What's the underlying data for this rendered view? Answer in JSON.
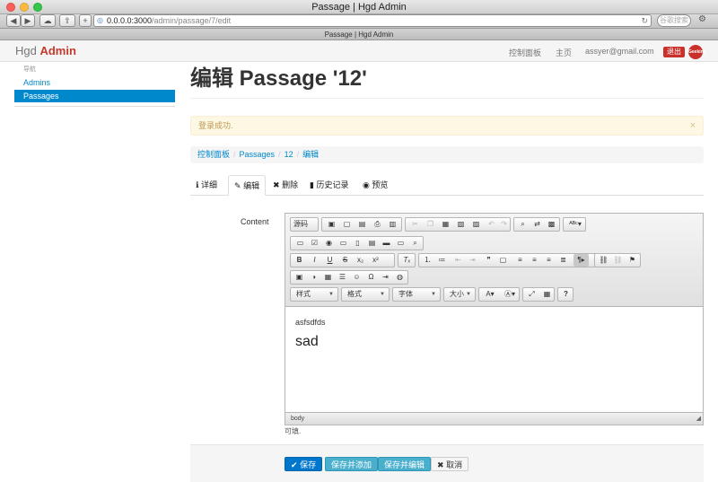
{
  "window": {
    "title": "Passage | Hgd Admin",
    "tab": "Passage | Hgd Admin"
  },
  "browser": {
    "url_host": "0.0.0.0:3000",
    "url_path": "/admin/passage/7/edit",
    "search_placeholder": "谷歌搜索"
  },
  "navbar": {
    "brand_prefix": "Hgd ",
    "brand_highlight": "Admin",
    "links": [
      "控制面板",
      "主页"
    ],
    "user_email": "assyer@gmail.com",
    "logout_label": "退出",
    "avatar_text": "Geeking"
  },
  "sidebar": {
    "header": "导航",
    "items": [
      {
        "label": "Admins",
        "active": false
      },
      {
        "label": "Passages",
        "active": true
      }
    ]
  },
  "page": {
    "title": "编辑 Passage '12'"
  },
  "alert": {
    "message": "登录成功.",
    "close": "×"
  },
  "breadcrumb": {
    "items": [
      "控制面板",
      "Passages",
      "12",
      "编辑"
    ],
    "separator": "/"
  },
  "tabs": [
    {
      "icon": "info-icon",
      "glyph": "ℹ",
      "label": "详细",
      "active": false
    },
    {
      "icon": "pencil-icon",
      "glyph": "✎",
      "label": "编辑",
      "active": true
    },
    {
      "icon": "delete-icon",
      "glyph": "✖",
      "label": "删除",
      "active": false
    },
    {
      "icon": "book-icon",
      "glyph": "▮",
      "label": "历史记录",
      "active": false
    },
    {
      "icon": "eye-icon",
      "glyph": "◉",
      "label": "预览",
      "active": false
    }
  ],
  "form": {
    "content_label": "Content",
    "hint": "可填.",
    "editor": {
      "source_label": "源码",
      "combos": [
        {
          "label": "样式",
          "icon": "styles-combo"
        },
        {
          "label": "格式",
          "icon": "format-combo"
        },
        {
          "label": "字体",
          "icon": "font-combo"
        },
        {
          "label": "大小",
          "icon": "size-combo"
        }
      ],
      "status_path": "body",
      "paragraph_text": "asfsdfds",
      "heading_text": "sad"
    },
    "buttons": [
      {
        "label": "保存",
        "icon": "check-icon",
        "glyph": "✔",
        "color": "#0077cc"
      },
      {
        "label": "保存并添加",
        "icon": "",
        "glyph": "",
        "color": "#49afcd"
      },
      {
        "label": "保存并编辑",
        "icon": "",
        "glyph": "",
        "color": "#49afcd"
      },
      {
        "label": "取消",
        "icon": "cancel-icon",
        "glyph": "✖",
        "color": "#f5f5f5"
      }
    ]
  }
}
